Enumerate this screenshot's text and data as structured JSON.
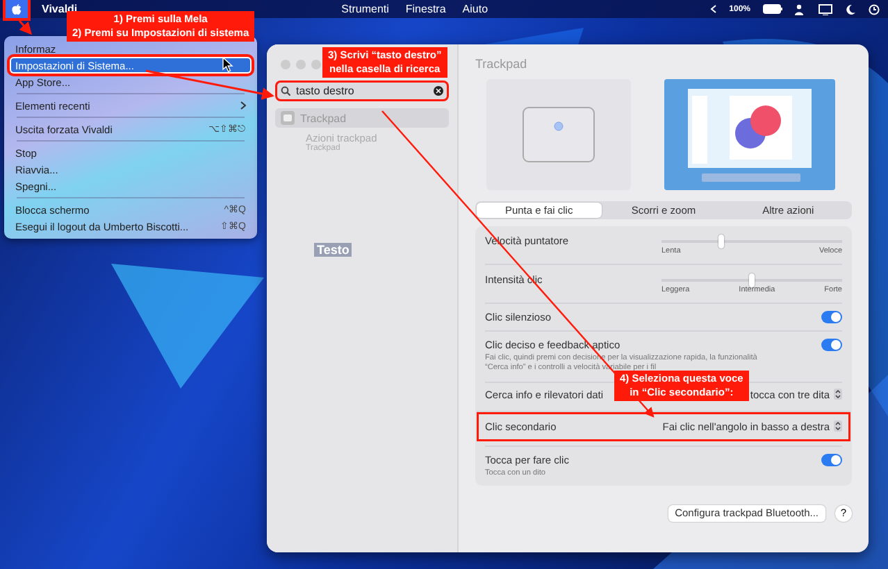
{
  "menu_bar": {
    "apple": {
      "highlighted": true
    },
    "app_name": "Vivaldi",
    "items": [
      "Strumenti",
      "Finestra",
      "Aiuto"
    ],
    "battery": "100%"
  },
  "apple_menu": {
    "items": [
      {
        "kind": "item",
        "label": "Informaz",
        "selected": false,
        "highlighted": false
      },
      {
        "kind": "item",
        "label": "Impostazioni di Sistema...",
        "selected": true,
        "highlighted": true
      },
      {
        "kind": "item",
        "label": "App Store...",
        "selected": false,
        "highlighted": false
      },
      {
        "kind": "separator"
      },
      {
        "kind": "submenu",
        "label": "Elementi recenti",
        "selected": false,
        "highlighted": false
      },
      {
        "kind": "separator"
      },
      {
        "kind": "item",
        "label": "Uscita forzata Vivaldi",
        "shortcut": "⌥⇧⌘⎋",
        "selected": false,
        "highlighted": false
      },
      {
        "kind": "separator"
      },
      {
        "kind": "item",
        "label": "Stop",
        "selected": false,
        "highlighted": false
      },
      {
        "kind": "item",
        "label": "Riavvia...",
        "selected": false,
        "highlighted": false
      },
      {
        "kind": "item",
        "label": "Spegni...",
        "selected": false,
        "highlighted": false
      },
      {
        "kind": "separator"
      },
      {
        "kind": "item",
        "label": "Blocca schermo",
        "shortcut": "^⌘Q",
        "selected": false,
        "highlighted": false
      },
      {
        "kind": "item",
        "label": "Esegui il logout da Umberto Biscotti...",
        "shortcut": "⇧⌘Q",
        "selected": false,
        "highlighted": false
      }
    ]
  },
  "settings_window": {
    "search": {
      "value": "tasto destro",
      "highlighted": true
    },
    "results": [
      {
        "label": "Trackpad",
        "selected": true
      },
      {
        "label": "Azioni trackpad",
        "sublabel": "Trackpad",
        "selected": false
      }
    ],
    "sidebar_label": "Testo",
    "title": "Trackpad",
    "tabs": [
      {
        "label": "Punta e fai clic",
        "selected": true
      },
      {
        "label": "Scorri e zoom",
        "selected": false
      },
      {
        "label": "Altre azioni",
        "selected": false
      }
    ],
    "rows": [
      {
        "kind": "slider",
        "label": "Velocità puntatore",
        "level": 0.33,
        "scale": [
          "Lenta",
          "Veloce"
        ],
        "highlighted": false
      },
      {
        "kind": "slider",
        "label": "Intensità clic",
        "level": 0.5,
        "scale": [
          "Leggera",
          "Intermedia",
          "Forte"
        ],
        "highlighted": false
      },
      {
        "kind": "toggle",
        "label": "Clic silenzioso",
        "on": true,
        "highlighted": false
      },
      {
        "kind": "toggle",
        "label": "Clic deciso e feedback aptico",
        "description": "Fai clic, quindi premi con decisione per la visualizzazione rapida, la funzionalità “Cerca info” e i controlli a velocità variabile per i fil",
        "on": true,
        "highlighted": false
      },
      {
        "kind": "select",
        "label": "Cerca info e rilevatori dati",
        "value": "tocca con tre dita",
        "highlighted": false
      },
      {
        "kind": "select",
        "label": "Clic secondario",
        "value": "Fai clic nell'angolo in basso a destra",
        "highlighted": true
      },
      {
        "kind": "toggle",
        "label": "Tocca per fare clic",
        "description": "Tocca con un dito",
        "on": true,
        "highlighted": false
      }
    ],
    "footer_button": "Configura trackpad Bluetooth...",
    "help": "?"
  },
  "annotations": [
    {
      "lines": [
        "1) Premi sulla Mela",
        "2) Premi su Impostazioni di sistema"
      ]
    },
    {
      "lines": [
        "3) Scrivi “tasto destro”",
        "nella casella di ricerca"
      ]
    },
    {
      "lines": [
        "4) Seleziona questa voce",
        "in “Clic secondario”:"
      ]
    }
  ]
}
